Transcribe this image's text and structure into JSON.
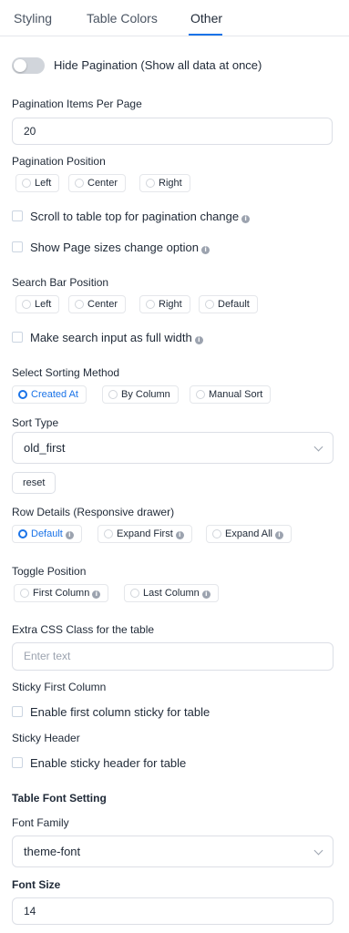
{
  "tabs": [
    {
      "label": "Styling"
    },
    {
      "label": "Table Colors"
    },
    {
      "label": "Other"
    }
  ],
  "accent_color": "#1a73e8",
  "pagination": {
    "hide_label": "Hide Pagination (Show all data at once)",
    "hide_enabled": false,
    "items_per_page_label": "Pagination Items Per Page",
    "items_per_page_value": "20",
    "position_label": "Pagination Position",
    "position_options": [
      "Left",
      "Center",
      "Right"
    ],
    "scroll_top_label": "Scroll to table top for pagination change",
    "show_page_sizes_label": "Show Page sizes change option"
  },
  "search": {
    "position_label": "Search Bar Position",
    "position_options": [
      "Left",
      "Center",
      "Right",
      "Default"
    ],
    "full_width_label": "Make search input as full width"
  },
  "sorting": {
    "method_label": "Select Sorting Method",
    "method_options": [
      "Created At",
      "By Column",
      "Manual Sort"
    ],
    "method_selected": "Created At",
    "type_label": "Sort Type",
    "type_value": "old_first",
    "reset_label": "reset"
  },
  "row_details": {
    "label": "Row Details (Responsive drawer)",
    "options": [
      "Default",
      "Expand First",
      "Expand All"
    ],
    "selected": "Default"
  },
  "toggle_position": {
    "label": "Toggle Position",
    "options": [
      "First Column",
      "Last Column"
    ]
  },
  "extra_css": {
    "label": "Extra CSS Class for the table",
    "placeholder": "Enter text"
  },
  "sticky_first": {
    "label": "Sticky First Column",
    "checkbox_label": "Enable first column sticky for table"
  },
  "sticky_header": {
    "label": "Sticky Header",
    "checkbox_label": "Enable sticky header for table"
  },
  "font": {
    "section_label": "Table Font Setting",
    "family_label": "Font Family",
    "family_value": "theme-font",
    "size_label": "Font Size",
    "size_value": "14"
  },
  "icons": {
    "info": "info-icon",
    "chevron": "chevron-down-icon"
  }
}
